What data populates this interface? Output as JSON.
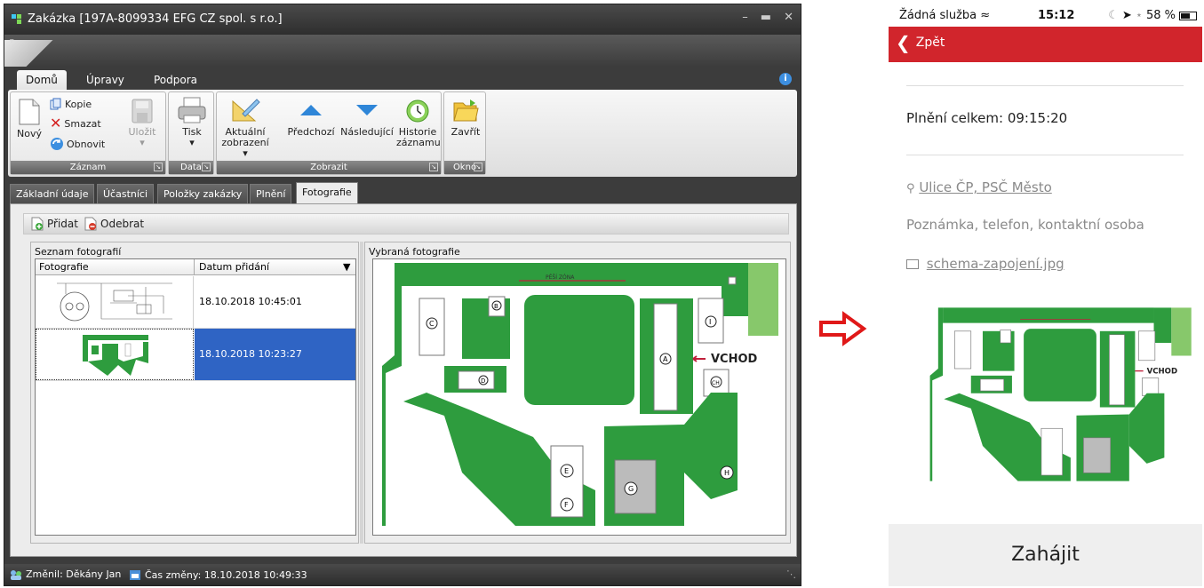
{
  "desktop": {
    "title": "Zakázka [197A-8099334 EFG CZ spol. s r.o.]",
    "ribbon_tabs": [
      "Domů",
      "Úpravy",
      "Podpora"
    ],
    "info_icon": "i",
    "ribbon": {
      "new": "Nový",
      "copy": "Kopie",
      "delete": "Smazat",
      "refresh": "Obnovit",
      "save": "Uložit",
      "save_arrow": "▾",
      "print": "Tisk",
      "print_arrow": "▾",
      "current_view_1": "Aktuální",
      "current_view_2": "zobrazení ▾",
      "previous": "Předchozí",
      "next": "Následující",
      "history_1": "Historie",
      "history_2": "záznamu",
      "close": "Zavřít",
      "group_record": "Záznam",
      "group_data": "Data",
      "group_view": "Zobrazit",
      "group_window": "Okno"
    },
    "page_tabs": [
      "Základní údaje",
      "Účastníci",
      "Položky zakázky",
      "Plnění",
      "Fotografie"
    ],
    "toolbar": {
      "add": "Přidat",
      "remove": "Odebrat"
    },
    "photo_list": {
      "title": "Seznam fotografií",
      "col_photo": "Fotografie",
      "col_date": "Datum přidání",
      "rows": [
        {
          "date": "18.10.2018 10:45:01"
        },
        {
          "date": "18.10.2018 10:23:27"
        }
      ]
    },
    "selected_photo": {
      "title": "Vybraná fotografie"
    },
    "map": {
      "walk_zone": "PĚŠÍ ZÓNA",
      "entrance": "VCHOD",
      "letters": [
        "A",
        "B",
        "C",
        "D",
        "E",
        "F",
        "G",
        "H",
        "I",
        "CH"
      ]
    },
    "status": {
      "changed_by": "Změnil: Děkány Jan",
      "changed_time": "Čas změny: 18.10.2018 10:49:33"
    }
  },
  "phone": {
    "carrier": "Žádná služba",
    "time": "15:12",
    "battery": "58 %",
    "back": "Zpět",
    "total": "Plnění celkem: 09:15:20",
    "address": "Ulice ČP, PSČ Město",
    "note": "Poznámka, telefon, kontaktní osoba",
    "attachment": "schema-zapojení.jpg",
    "start": "Zahájit"
  },
  "colors": {
    "accent_red": "#d1252c",
    "selection_blue": "#2f64c4",
    "map_green": "#2e9c3e"
  }
}
